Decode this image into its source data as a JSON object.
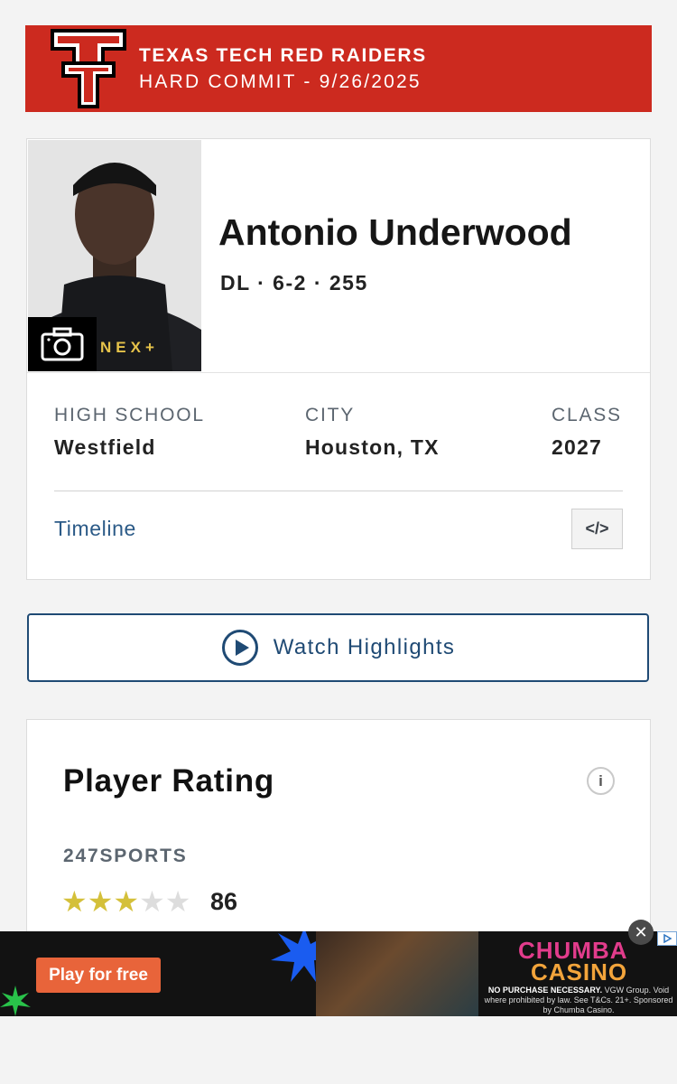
{
  "banner": {
    "team": "TEXAS TECH RED RAIDERS",
    "status": "HARD COMMIT - 9/26/2025",
    "logo_icon": "double-t-logo",
    "color": "#cc2a1f"
  },
  "player": {
    "name": "Antonio Underwood",
    "meta": "DL · 6-2 · 255",
    "photo_icon": "camera-icon",
    "photo_badge": "NEX+"
  },
  "details": {
    "high_school_label": "HIGH SCHOOL",
    "high_school": "Westfield",
    "city_label": "CITY",
    "city": "Houston, TX",
    "class_label": "CLASS",
    "class": "2027"
  },
  "timeline": {
    "label": "Timeline",
    "embed_label": "</>"
  },
  "highlights": {
    "label": "Watch Highlights",
    "icon": "play-circle-icon"
  },
  "rating": {
    "title": "Player Rating",
    "source": "247SPORTS",
    "stars": 3,
    "max_stars": 5,
    "value": "86",
    "info_label": "i"
  },
  "ad": {
    "cta": "Play for free",
    "brand_line1": "CHUMBA",
    "brand_line2": "CASINO",
    "legal_bold": "NO PURCHASE NECESSARY.",
    "legal": "VGW Group. Void where prohibited by law. See T&Cs. 21+. Sponsored by Chumba Casino.",
    "close_label": "✕"
  }
}
